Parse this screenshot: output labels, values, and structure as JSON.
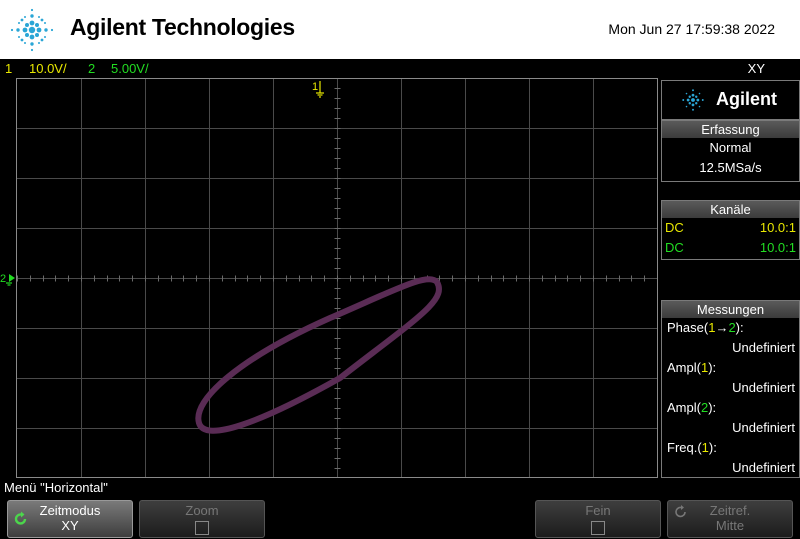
{
  "header": {
    "brand": "Agilent Technologies",
    "datetime": "Mon Jun 27 17:59:38 2022"
  },
  "status": {
    "ch1_num": "1",
    "ch1_scale": "10.0V/",
    "ch2_num": "2",
    "ch2_scale": "5.00V/",
    "mode": "XY"
  },
  "markers": {
    "ch1_trigger": "1",
    "ch2_ground": "2"
  },
  "colors": {
    "ch1": "#e8e800",
    "ch2": "#22dd22",
    "trace": "#5a2c55",
    "grid": "#4a4a4a"
  },
  "panel": {
    "brand": "Agilent",
    "acquisition": {
      "title": "Erfassung",
      "mode": "Normal",
      "rate": "12.5MSa/s"
    },
    "channels": {
      "title": "Kanäle",
      "rows": [
        {
          "coupling": "DC",
          "probe": "10.0:1"
        },
        {
          "coupling": "DC",
          "probe": "10.0:1"
        }
      ]
    },
    "measurements": {
      "title": "Messungen",
      "items": [
        {
          "name": "Phase(",
          "ch": "1",
          "arrow": "→",
          "ch2": "2",
          "close": "):",
          "value": "Undefiniert"
        },
        {
          "name": "Ampl(",
          "ch": "1",
          "close": "):",
          "value": "Undefiniert"
        },
        {
          "name": "Ampl(",
          "ch": "2",
          "close": "):",
          "value": "Undefiniert"
        },
        {
          "name": "Freq.(",
          "ch": "1",
          "close": "):",
          "value": "Undefiniert"
        }
      ]
    }
  },
  "menu": {
    "title": "Menü \"Horizontal\"",
    "softkeys": [
      {
        "label": "Zeitmodus",
        "value": "XY"
      },
      {
        "label": "Zoom"
      },
      {
        "label": "Fein"
      },
      {
        "label": "Zeitref.",
        "value": "Mitte"
      }
    ]
  }
}
